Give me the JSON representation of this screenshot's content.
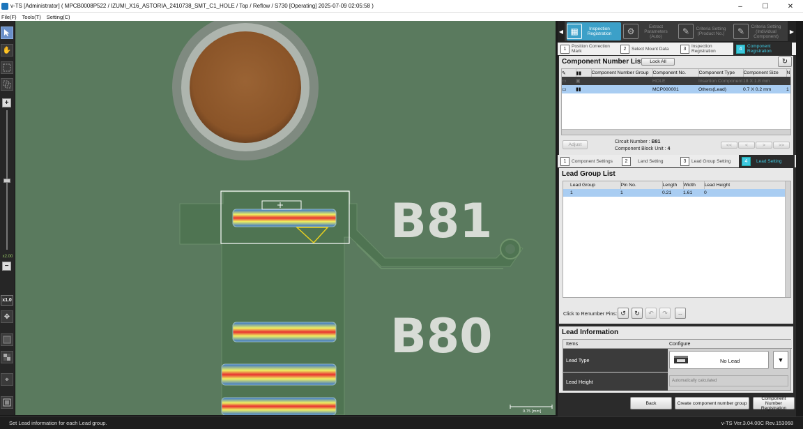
{
  "titlebar": {
    "title": "v-TS [Administrator] ( MPCB0008P522  /  IZUMI_X16_ASTORIA_2410738_SMT_C1_HOLE  /  Top  /  Reflow  /  S730  [Operating]  2025-07-09 02:05:58 )",
    "minimize": "–",
    "maximize": "☐",
    "close": "✕"
  },
  "menu": {
    "file": "File(F)",
    "tools": "Tools(T)",
    "setting": "Setting(C)"
  },
  "toolbar": {
    "zoom_plus": "+",
    "zoom_minus": "−",
    "zoom_level": "x2.00",
    "x10_label": "x1.0"
  },
  "canvas": {
    "silk_b81": "B81",
    "silk_b80": "B80",
    "scale_label": "0.75 [mm]"
  },
  "wizard": {
    "steps": [
      {
        "label": "Inspection Registration",
        "icon": "grid-icon",
        "active": true
      },
      {
        "label": "Extract Parameters (Auto)",
        "icon": "gear-icon",
        "active": false
      },
      {
        "label": "Criteria Setting (Product No.)",
        "icon": "edit-icon",
        "active": false
      },
      {
        "label": "Criteria Setting (Individual Component)",
        "icon": "edit-grid-icon",
        "active": false
      }
    ],
    "prev": "◀",
    "next": "▶"
  },
  "substeps_top": [
    {
      "num": "1",
      "label": "Position Correction Mark",
      "active": false
    },
    {
      "num": "2",
      "label": "Select Mount Data",
      "active": false
    },
    {
      "num": "3",
      "label": "Inspection Registration",
      "active": false
    },
    {
      "num": "4",
      "label": "Component Registration",
      "active": true
    }
  ],
  "component_list": {
    "title": "Component Number List",
    "lock_all": "Lock All",
    "refresh": "↻",
    "columns": [
      "Component Number Group",
      "Component No.",
      "Component Type",
      "Component Size",
      "N"
    ],
    "rows": [
      {
        "group": "",
        "no": "HOLE",
        "type": "Insertion Component",
        "size": "18 X 1.8 mm",
        "n": "",
        "dim": true
      },
      {
        "group": "",
        "no": "MCP000001",
        "type": "Others(Lead)",
        "size": "0.7 X 0.2 mm",
        "n": "1",
        "selected": true
      }
    ],
    "adjust": "Adjust",
    "circuit_number_label": "Circuit Number :",
    "circuit_number": "B81",
    "block_unit_label": "Component Block Unit :",
    "block_unit": "4",
    "nav": [
      "<<",
      "<",
      ">",
      ">>"
    ]
  },
  "substeps_bottom": [
    {
      "num": "1",
      "label": "Component Settings",
      "active": false
    },
    {
      "num": "2",
      "label": "Land Setting",
      "active": false
    },
    {
      "num": "3",
      "label": "Lead Group Setting",
      "active": false
    },
    {
      "num": "4",
      "label": "Lead Setting",
      "active": true
    }
  ],
  "lead_group": {
    "title": "Lead Group List",
    "columns": [
      "Lead Group",
      "Pin No.",
      "Length",
      "Width",
      "Lead Height"
    ],
    "rows": [
      {
        "group": "1",
        "pin": "1",
        "length": "0.21",
        "width": "1.61",
        "height": "0"
      }
    ],
    "renumber_label": "Click to Renumber Pins:",
    "renumber_buttons": [
      "↺",
      "↻",
      "↶",
      "↷",
      "..."
    ]
  },
  "lead_info": {
    "title": "Lead Information",
    "col_items": "Items",
    "col_configure": "Configure",
    "lead_type_label": "Lead Type",
    "lead_type_value": "No Lead",
    "dropdown": "▼",
    "lead_height_label": "Lead Height",
    "lead_height_value": "Automatically calculated"
  },
  "footer_buttons": {
    "back": "Back",
    "create_group": "Create component number group",
    "registration": "Component Number Registration"
  },
  "status": {
    "message": "Set Lead information for each Lead group.",
    "version": "v-TS Ver.3.04.00C Rev.153068"
  },
  "colors": {
    "accent": "#3ca0c8",
    "selected_row": "#a9cdf2",
    "board_green": "#55755a"
  }
}
